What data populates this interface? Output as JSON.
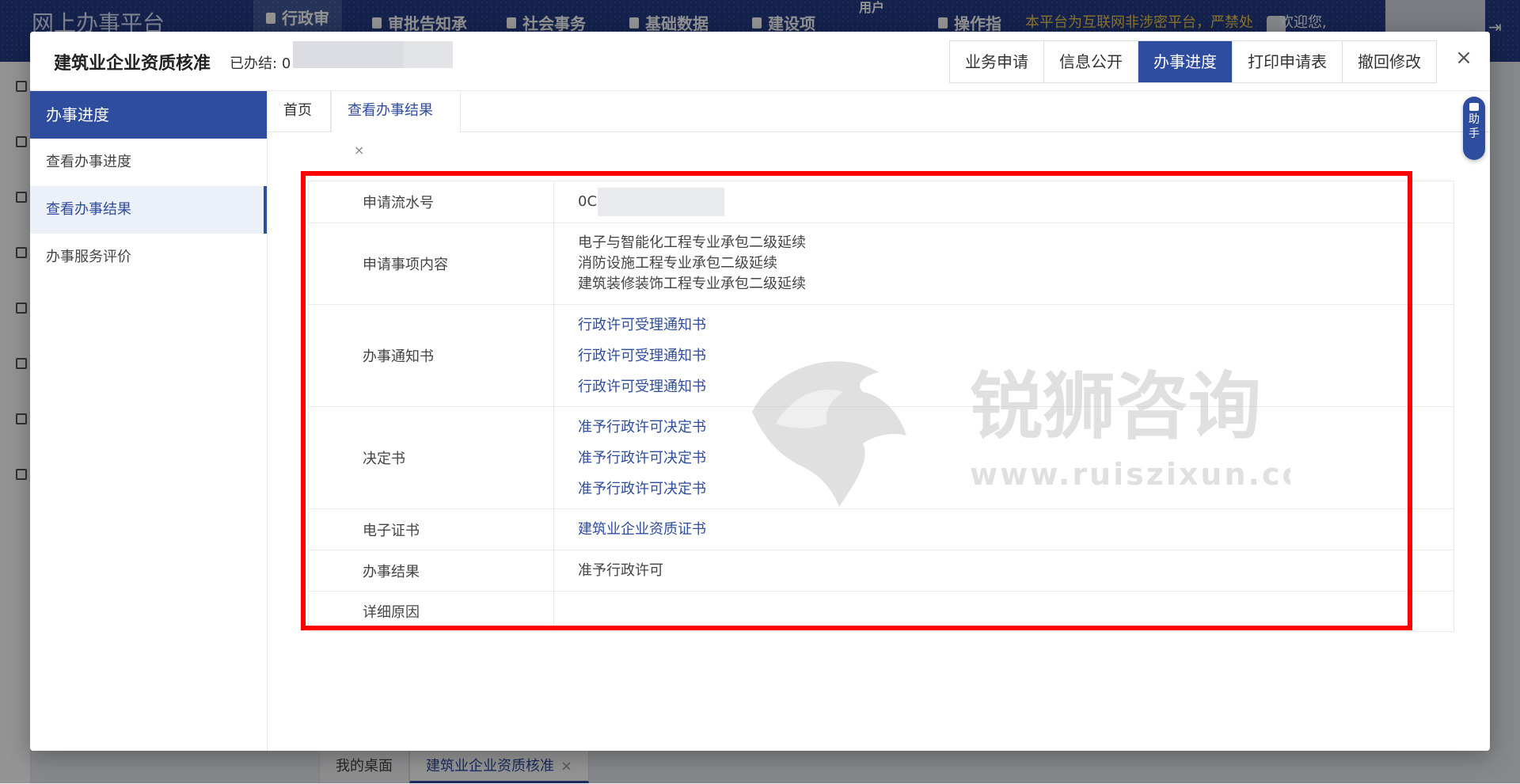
{
  "platform": {
    "title": "网上办事平台",
    "nav": [
      {
        "label": "行政审"
      },
      {
        "label": "审批告知承"
      },
      {
        "label": "社会事务"
      },
      {
        "label": "基础数据"
      },
      {
        "label": "建设项"
      },
      {
        "label": "用户"
      },
      {
        "label": "操作指"
      }
    ],
    "notice": "本平台为互联网非涉密平台，严禁处",
    "welcome": "欢迎您,",
    "bottom_tabs": [
      {
        "label": "我的桌面"
      },
      {
        "label": "建筑业企业资质核准"
      }
    ]
  },
  "modal": {
    "title": "建筑业企业资质核准",
    "done_label": "已办结:",
    "done_value": "0",
    "buttons": [
      "业务申请",
      "信息公开",
      "办事进度",
      "打印申请表",
      "撤回修改"
    ],
    "active_button": "办事进度",
    "close": "×"
  },
  "sidebar": {
    "header": "办事进度",
    "items": [
      "查看办事进度",
      "查看办事结果",
      "办事服务评价"
    ],
    "active": "查看办事结果"
  },
  "content_tabs": {
    "home": "首页",
    "current": "查看办事结果",
    "close": "×"
  },
  "helper": {
    "label_1": "助",
    "label_2": "手"
  },
  "result_table": {
    "serial_label": "申请流水号",
    "serial_value": "0C",
    "content_label": "申请事项内容",
    "content_lines": [
      "电子与智能化工程专业承包二级延续",
      "消防设施工程专业承包二级延续",
      "建筑装修装饰工程专业承包二级延续"
    ],
    "notice_label": "办事通知书",
    "notice_links": [
      "行政许可受理通知书",
      "行政许可受理通知书",
      "行政许可受理通知书"
    ],
    "decision_label": "决定书",
    "decision_links": [
      "准予行政许可决定书",
      "准予行政许可决定书",
      "准予行政许可决定书"
    ],
    "cert_label": "电子证书",
    "cert_link": "建筑业企业资质证书",
    "result_label": "办事结果",
    "result_value": "准予行政许可",
    "reason_label": "详细原因",
    "reason_value": ""
  },
  "watermark": {
    "brand": "锐狮咨询",
    "url": "www.ruiszixun.com"
  },
  "colors": {
    "primary": "#2f4d9f",
    "highlight": "#ff0000"
  }
}
